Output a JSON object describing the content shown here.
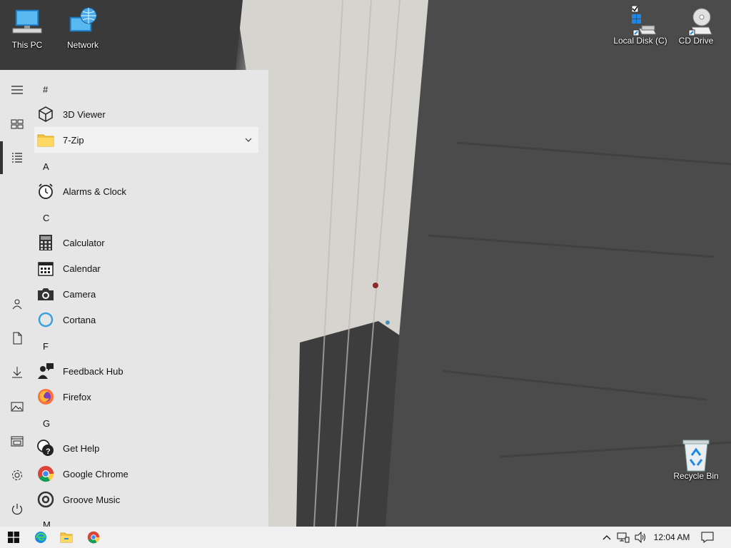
{
  "desktop": {
    "icons_left": [
      {
        "label": "This PC"
      },
      {
        "label": "Network"
      }
    ],
    "icons_right": [
      {
        "label": "Local Disk (C)"
      },
      {
        "label": "CD Drive"
      }
    ],
    "recycle_bin": {
      "label": "Recycle Bin"
    }
  },
  "start_menu": {
    "rail": [
      "hamburger-icon",
      "tiles-icon",
      "all-apps-icon",
      "user-icon",
      "documents-icon",
      "downloads-icon",
      "pictures-icon",
      "file-explorer-icon",
      "settings-icon",
      "power-icon"
    ],
    "sections": {
      "hash": "#",
      "a": "A",
      "c": "C",
      "f": "F",
      "g": "G",
      "m": "M"
    },
    "apps": {
      "viewer3d": "3D Viewer",
      "zip": "7-Zip",
      "alarms": "Alarms & Clock",
      "calculator": "Calculator",
      "calendar": "Calendar",
      "camera": "Camera",
      "cortana": "Cortana",
      "feedback": "Feedback Hub",
      "firefox": "Firefox",
      "gethelp": "Get Help",
      "chrome": "Google Chrome",
      "groove": "Groove Music"
    }
  },
  "taskbar": {
    "pinned": [
      "start-windows-icon",
      "edge-icon",
      "file-explorer-icon",
      "chrome-icon"
    ],
    "tray": [
      "show-hidden-icons-chevron",
      "network-icon",
      "volume-icon"
    ],
    "clock": "12:04 AM",
    "notification": "action-center-icon"
  },
  "colors": {
    "start_bg": "#e6e6e6",
    "taskbar_bg": "#f0f0f0",
    "highlight": "#f2f2f2",
    "folder": "#f4c542",
    "cortana": "#3aa0e0"
  }
}
